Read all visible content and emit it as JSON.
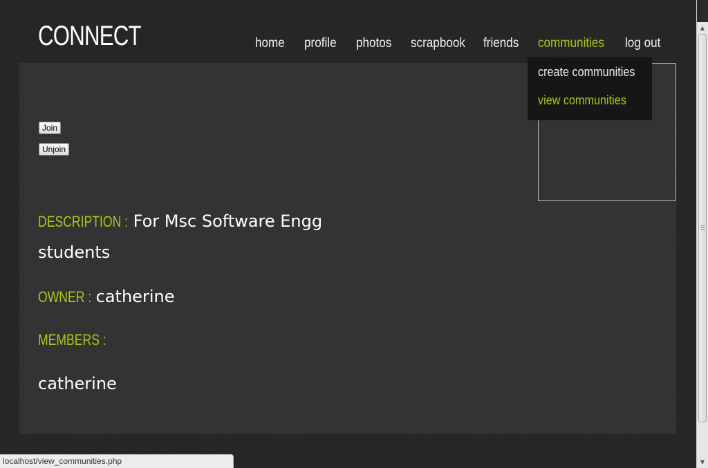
{
  "header": {
    "logo": "CONNECT"
  },
  "nav": {
    "items": [
      {
        "label": "home"
      },
      {
        "label": "profile"
      },
      {
        "label": "photos"
      },
      {
        "label": "scrapbook"
      },
      {
        "label": "friends"
      },
      {
        "label": "communities",
        "active": true
      },
      {
        "label": "log out"
      }
    ]
  },
  "dropdown": {
    "items": [
      {
        "label": "create communities"
      },
      {
        "label": "view communities",
        "hover": true
      }
    ]
  },
  "community": {
    "join_label": "Join",
    "unjoin_label": "Unjoin",
    "description_label": "DESCRIPTION :",
    "description": "For Msc Software Engg students",
    "owner_label": "OWNER :",
    "owner": "catherine",
    "members_label": "MEMBERS :",
    "members": [
      "catherine"
    ]
  },
  "status_bar": {
    "url": "localhost/view_communities.php"
  },
  "colors": {
    "accent": "#a8c81c",
    "panel": "#333333",
    "background": "#262626",
    "dropdown": "#161616"
  }
}
